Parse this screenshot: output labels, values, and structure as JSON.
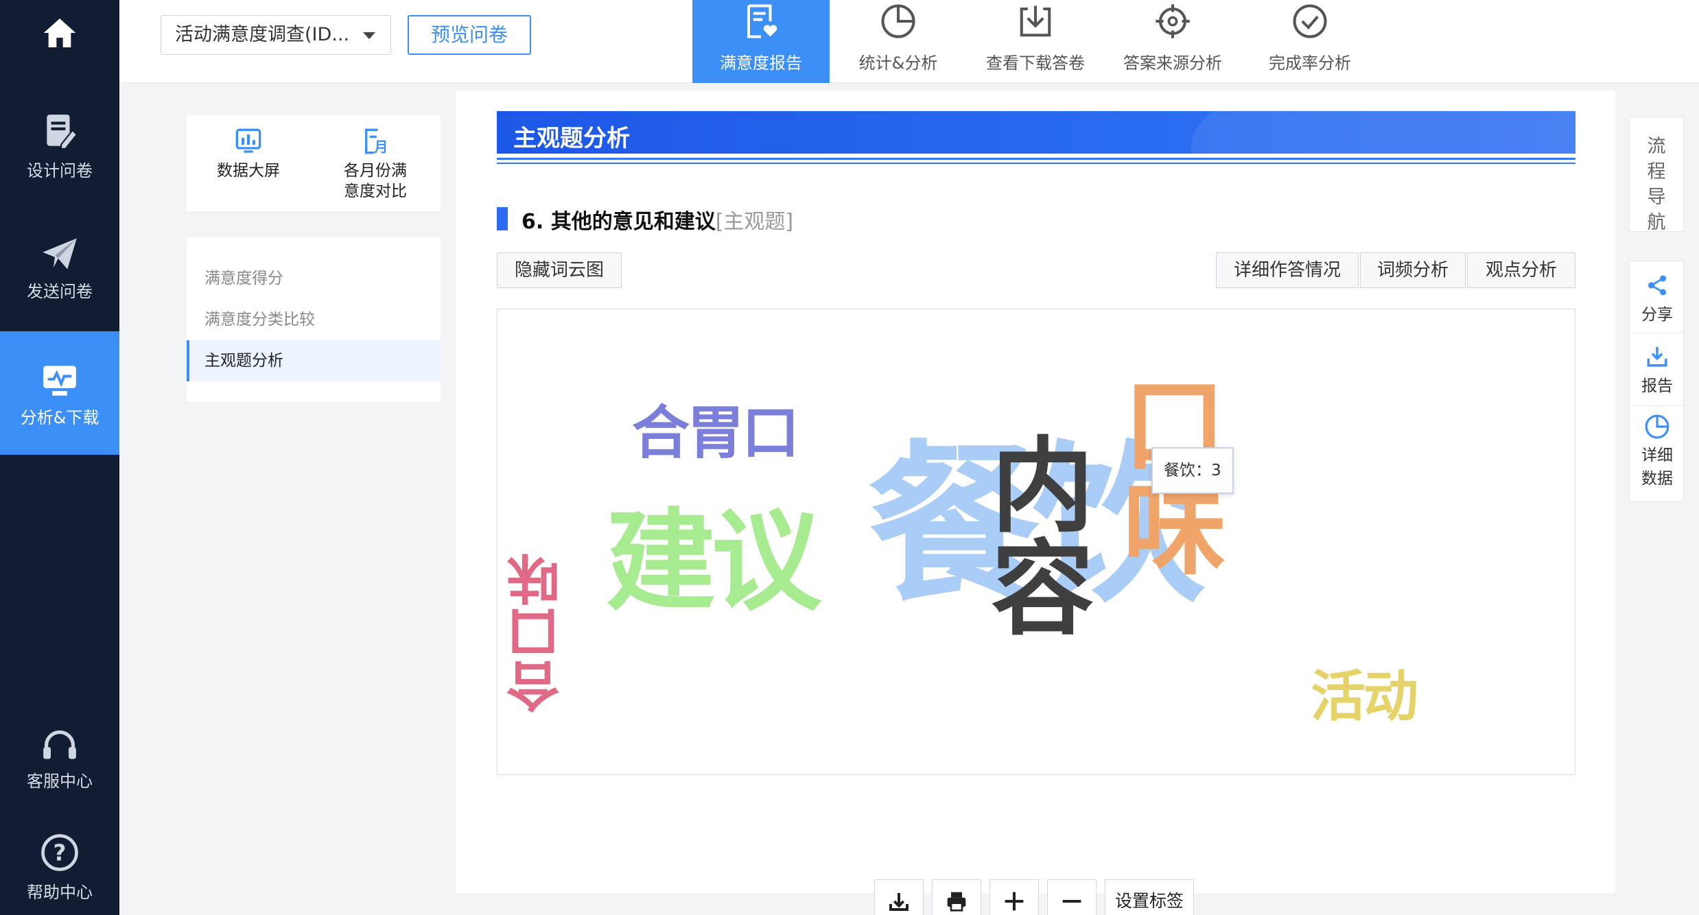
{
  "sidebar": {
    "home_label": "",
    "items": [
      {
        "label": "设计问卷",
        "icon": "edit-document-icon"
      },
      {
        "label": "发送问卷",
        "icon": "paper-plane-icon"
      },
      {
        "label": "分析&下载",
        "icon": "monitor-chart-icon",
        "active": true
      }
    ],
    "bottom": [
      {
        "label": "客服中心",
        "icon": "headset-icon"
      },
      {
        "label": "帮助中心",
        "icon": "question-circle-icon"
      }
    ]
  },
  "header": {
    "survey_select": "活动满意度调查(ID...",
    "preview_button": "预览问卷",
    "tabs": [
      {
        "label": "满意度报告",
        "icon": "report-heart-icon",
        "active": true
      },
      {
        "label": "统计&分析",
        "icon": "pie-chart-icon"
      },
      {
        "label": "查看下载答卷",
        "icon": "download-icon"
      },
      {
        "label": "答案来源分析",
        "icon": "target-icon"
      },
      {
        "label": "完成率分析",
        "icon": "check-circle-icon"
      }
    ]
  },
  "left_panel": {
    "quick": [
      {
        "label": "数据大屏",
        "icon": "dashboard-icon"
      },
      {
        "label_line1": "各月份满",
        "label_line2": "意度对比",
        "icon": "calendar-month-icon"
      }
    ],
    "menu": [
      {
        "label": "满意度得分"
      },
      {
        "label": "满意度分类比较"
      },
      {
        "label": "主观题分析",
        "active": true
      }
    ]
  },
  "main": {
    "banner_title": "主观题分析",
    "question": {
      "number_title": "6. 其他的意见和建议",
      "type_tag": "[主观题]"
    },
    "buttons": {
      "hide_cloud": "隐藏词云图",
      "detail": "详细作答情况",
      "freq": "词频分析",
      "opinion": "观点分析"
    },
    "wordcloud": {
      "words": [
        {
          "text": "餐饮",
          "color": "#a9cdf6"
        },
        {
          "text": "建议",
          "color": "#a6eb8f"
        },
        {
          "text": "合胃口",
          "color": "#7b7fd9"
        },
        {
          "text": "内容",
          "color": "#3f3f3f"
        },
        {
          "text": "口味",
          "color": "#efa56a"
        },
        {
          "text": "合口味",
          "color": "#e06a86"
        },
        {
          "text": "活动",
          "color": "#e5d36a"
        }
      ],
      "tooltip": "餐饮：3"
    },
    "toolbar": {
      "set_label": "设置标签"
    }
  },
  "right_panel": {
    "nav_label": "流程导航",
    "items": [
      {
        "label": "分享",
        "icon": "share-icon"
      },
      {
        "label": "报告",
        "icon": "download-report-icon"
      },
      {
        "label_line1": "详细",
        "label_line2": "数据",
        "icon": "pie-detail-icon"
      }
    ]
  },
  "colors": {
    "accent": "#3b8ff7",
    "sidebar_bg": "#111d33",
    "banner": "#1d57e6"
  }
}
